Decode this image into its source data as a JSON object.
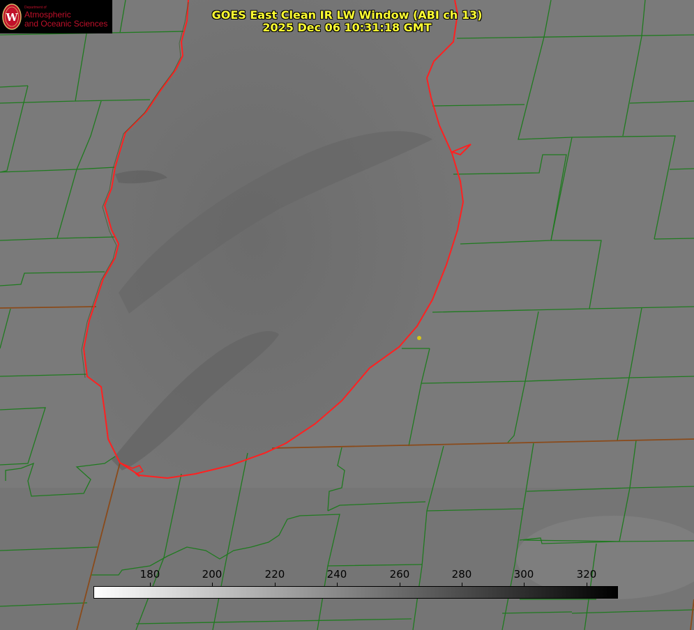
{
  "title": {
    "line1": "GOES East Clean IR LW Window (ABI ch 13)",
    "line2": "2025 Dec 06 10:31:18 GMT"
  },
  "logo": {
    "department": "Department of",
    "line1": "Atmospheric",
    "line2": "and Oceanic Sciences",
    "seal_letter": "W"
  },
  "colorbar": {
    "ticks": [
      "180",
      "200",
      "220",
      "240",
      "260",
      "280",
      "300",
      "320"
    ],
    "gradient_from": "#ffffff",
    "gradient_to": "#000000"
  },
  "colors": {
    "county_lines": "#1f7a1f",
    "lake_outline": "#ff2020",
    "title_text": "#ffff33",
    "marker": "#d4c41a",
    "logo_red": "#c0102a"
  },
  "icons": [
    "uw-seal-icon",
    "location-marker-icon"
  ]
}
